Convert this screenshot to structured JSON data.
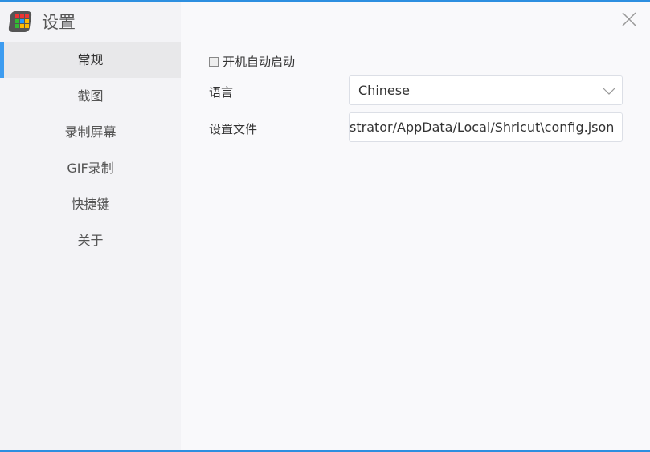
{
  "window": {
    "title": "设置",
    "accent": "#2d8fe0"
  },
  "sidebar": {
    "items": [
      {
        "label": "常规",
        "active": true
      },
      {
        "label": "截图"
      },
      {
        "label": "录制屏幕"
      },
      {
        "label": "GIF录制"
      },
      {
        "label": "快捷键"
      },
      {
        "label": "关于"
      }
    ]
  },
  "general": {
    "autostart": {
      "label": "开机自动启动",
      "checked": false
    },
    "language": {
      "label": "语言",
      "value": "Chinese"
    },
    "config_file": {
      "label": "设置文件",
      "value": "strator/AppData/Local/Shricut\\config.json"
    }
  },
  "icons": {
    "close": "close-icon",
    "dropdown": "chevron-down-icon",
    "logo": "app-logo"
  }
}
